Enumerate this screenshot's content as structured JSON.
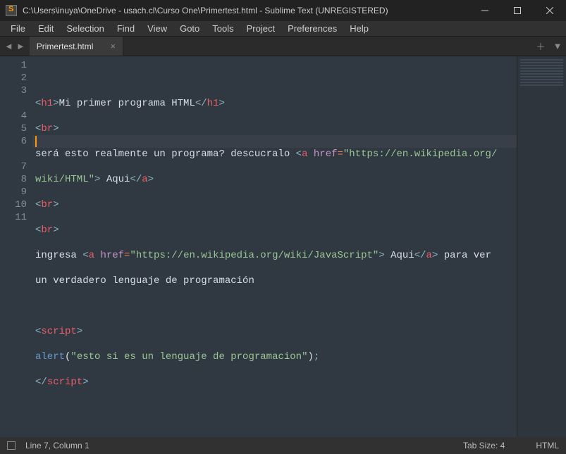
{
  "title": "C:\\Users\\inuya\\OneDrive - usach.cl\\Curso One\\Primertest.html - Sublime Text (UNREGISTERED)",
  "menu": {
    "file": "File",
    "edit": "Edit",
    "selection": "Selection",
    "find": "Find",
    "view": "View",
    "goto": "Goto",
    "tools": "Tools",
    "project": "Project",
    "preferences": "Preferences",
    "help": "Help"
  },
  "tab": {
    "name": "Primertest.html"
  },
  "gutter": [
    "1",
    "2",
    "3",
    "4",
    "5",
    "6",
    "7",
    "8",
    "9",
    "10",
    "11"
  ],
  "code": {
    "l1": {
      "a": "<",
      "b": "h1",
      "c": ">",
      "d": "Mi primer programa HTML",
      "e": "</",
      "f": "h1",
      "g": ">"
    },
    "l2": {
      "a": "<",
      "b": "br",
      "c": ">"
    },
    "l3a": {
      "a": "será esto realmente un programa? descucralo ",
      "b": "<",
      "c": "a",
      "d": " ",
      "e": "href",
      "f": "=",
      "g": "\"https://en.wikipedia.org/"
    },
    "l3b": {
      "a": "wiki/HTML\"",
      "b": ">",
      "c": " Aqui",
      "d": "</",
      "e": "a",
      "f": ">"
    },
    "l4": {
      "a": "<",
      "b": "br",
      "c": ">"
    },
    "l5": {
      "a": "<",
      "b": "br",
      "c": ">"
    },
    "l6a": {
      "a": "ingresa ",
      "b": "<",
      "c": "a",
      "d": " ",
      "e": "href",
      "f": "=",
      "g": "\"https://en.wikipedia.org/wiki/JavaScript\"",
      "h": ">",
      "i": " Aqui",
      "j": "</",
      "k": "a",
      "l": ">",
      "m": " para ver "
    },
    "l6b": {
      "a": "un verdadero lenguaje de programación"
    },
    "l8": {
      "a": "<",
      "b": "script",
      "c": ">"
    },
    "l9": {
      "a": "alert",
      "b": "(",
      "c": "\"esto si es un lenguaje de programacion\"",
      "d": ")",
      "e": ";"
    },
    "l10": {
      "a": "</",
      "b": "script",
      "c": ">"
    }
  },
  "status": {
    "cursor": "Line 7, Column 1",
    "tabsize": "Tab Size: 4",
    "syntax": "HTML"
  }
}
